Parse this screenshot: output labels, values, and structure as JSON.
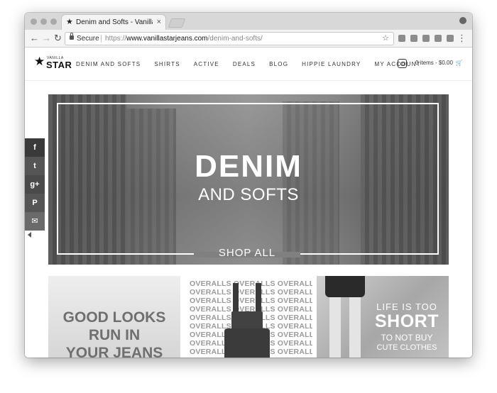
{
  "browser": {
    "tab_title": "Denim and Softs - Vanilla Star",
    "tab_close": "×",
    "secure_label": "Secure",
    "url_scheme": "https://",
    "url_domain": "www.vanillastarjeans.com",
    "url_path": "/denim-and-softs/",
    "back_glyph": "←",
    "forward_glyph": "→",
    "reload_glyph": "↻",
    "bookmark_glyph": "☆",
    "menu_glyph": "⋮",
    "tab_favicon": "★"
  },
  "site": {
    "logo_small": "VANILLA",
    "logo_big": "STAR",
    "logo_star": "★",
    "nav": [
      "DENIM AND SOFTS",
      "SHIRTS",
      "ACTIVE",
      "DEALS",
      "BLOG",
      "HIPPIE LAUNDRY",
      "MY ACCOUNT"
    ],
    "cart_text": "0 items - $0.00",
    "cart_icon": "🛒"
  },
  "social": [
    "f",
    "t",
    "g+",
    "P",
    "✉"
  ],
  "hero": {
    "title": "DENIM",
    "subtitle": "AND SOFTS",
    "cta": "SHOP ALL"
  },
  "tiles": {
    "tile1_lines": [
      "GOOD LOOKS",
      "RUN IN",
      "YOUR JEANS"
    ],
    "tile2_rows": [
      "OVERALLS OVERALLS OVERALLS",
      "OVERALLS OVERALLS OVERALLS",
      "OVERALLS OVERALLS OVERALLS",
      "OVERALLS OVERALLS OVERALLS",
      "OVERALLS OVERALLS OVERALLS",
      "OVERALLS OVERALLS OVERALLS",
      "OVERALLS OVERALLS OVERALLS",
      "OVERALLS OVERALLS OVERALLS",
      "OVERALLS OVERALLS OVERALLS"
    ],
    "tile3_line1": "LIFE IS TOO",
    "tile3_line2": "SHORT",
    "tile3_line3": "TO NOT BUY",
    "tile3_line4": "CUTE CLOTHES"
  }
}
